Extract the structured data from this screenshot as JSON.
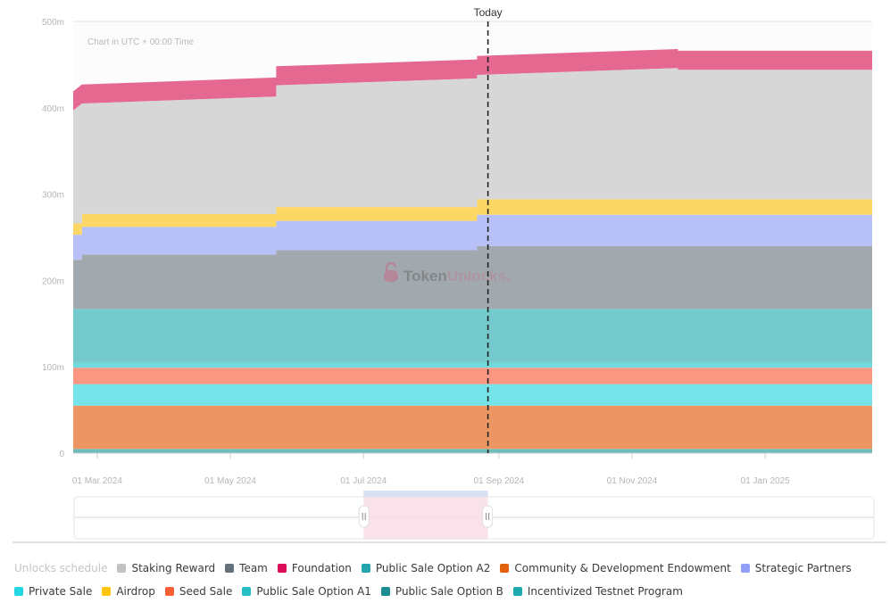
{
  "chart_data": {
    "type": "area",
    "stacked": true,
    "step": true,
    "title": "",
    "note": "Chart in UTC + 00:00 Time",
    "xlabel": "",
    "ylabel": "",
    "ylim": [
      0,
      500
    ],
    "y_unit": "m",
    "yticks": [
      "0",
      "100m",
      "200m",
      "300m",
      "400m",
      "500m"
    ],
    "ytick_values": [
      0,
      100,
      200,
      300,
      400,
      500
    ],
    "xlim": [
      "2024-02-19",
      "2025-02-19"
    ],
    "xticks": [
      "01 Mar 2024",
      "01 May 2024",
      "01 Jul 2024",
      "01 Sep 2024",
      "01 Nov 2024",
      "01 Jan 2025"
    ],
    "xtick_dates": [
      "2024-03-01",
      "2024-05-01",
      "2024-07-01",
      "2024-09-01",
      "2024-11-01",
      "2025-01-01"
    ],
    "today": {
      "label": "Today",
      "date": "2024-08-27"
    },
    "grid": true,
    "legend_position": "bottom",
    "watermark": {
      "part1": "Token",
      "part2": "Unlocks",
      "dot": "."
    },
    "x": [
      "2024-02-19",
      "2024-02-23",
      "2024-05-22",
      "2024-08-22",
      "2024-11-22",
      "2025-02-19"
    ],
    "series": [
      {
        "name": "Incentivized Testnet Program",
        "color": "#6fbcbc",
        "values": [
          5,
          5,
          5,
          5,
          5,
          5
        ]
      },
      {
        "name": "Community & Development Endowment",
        "color": "#ec9663",
        "values": [
          50,
          50,
          50,
          50,
          50,
          50
        ]
      },
      {
        "name": "Private Sale",
        "color": "#75e3e8",
        "values": [
          25,
          25,
          25,
          25,
          25,
          25
        ]
      },
      {
        "name": "Seed Sale",
        "color": "#fb9682",
        "values": [
          19,
          19,
          19,
          19,
          19,
          19
        ]
      },
      {
        "name": "Public Sale Option A1",
        "color": "#71dadf",
        "values": [
          6,
          6,
          6,
          6,
          6,
          6
        ]
      },
      {
        "name": "Public Sale Option B",
        "color": "#5fb3b3",
        "values": [
          0.5,
          0.5,
          0.5,
          0.5,
          0.5,
          0.5
        ]
      },
      {
        "name": "Public Sale Option A2",
        "color": "#73c9cc",
        "values": [
          61.5,
          61.5,
          61.5,
          61.5,
          61.5,
          61.5
        ]
      },
      {
        "name": "Team",
        "color": "#a1a9ae",
        "values": [
          57,
          63,
          68,
          73,
          73,
          73
        ]
      },
      {
        "name": "Strategic Partners",
        "color": "#b7c1f7",
        "values": [
          29,
          32,
          34,
          36,
          36,
          36
        ]
      },
      {
        "name": "Airdrop",
        "color": "#fcd766",
        "values": [
          13,
          15,
          16,
          18,
          18,
          18
        ]
      },
      {
        "name": "Staking Reward",
        "color": "#d7d7d7",
        "values": [
          131,
          128,
          141,
          144,
          150,
          162
        ]
      },
      {
        "name": "Foundation",
        "color": "#e56891",
        "values": [
          22,
          22,
          22,
          22,
          22,
          27
        ]
      }
    ],
    "staking_ramp_note": "Staking Reward and Foundation rise linearly between steps"
  },
  "legend": {
    "title": "Unlocks schedule",
    "rows": [
      [
        {
          "label": "Staking Reward",
          "color": "#c2c2c2"
        },
        {
          "label": "Team",
          "color": "#65717a"
        },
        {
          "label": "Foundation",
          "color": "#dc0a57"
        },
        {
          "label": "Public Sale Option A2",
          "color": "#25a6ae"
        },
        {
          "label": "Community & Development Endowment",
          "color": "#e2620e"
        },
        {
          "label": "Strategic Partners",
          "color": "#8fa0f6"
        }
      ],
      [
        {
          "label": "Private Sale",
          "color": "#22d7e2"
        },
        {
          "label": "Airdrop",
          "color": "#fcc40a"
        },
        {
          "label": "Seed Sale",
          "color": "#fb6035"
        },
        {
          "label": "Public Sale Option A1",
          "color": "#26bec5"
        },
        {
          "label": "Public Sale Option B",
          "color": "#1c8d8f"
        },
        {
          "label": "Incentivized Testnet Program",
          "color": "#1faab0"
        }
      ]
    ]
  },
  "navigator": {
    "range_start": "2024-07-01",
    "range_end": "2024-08-27"
  }
}
